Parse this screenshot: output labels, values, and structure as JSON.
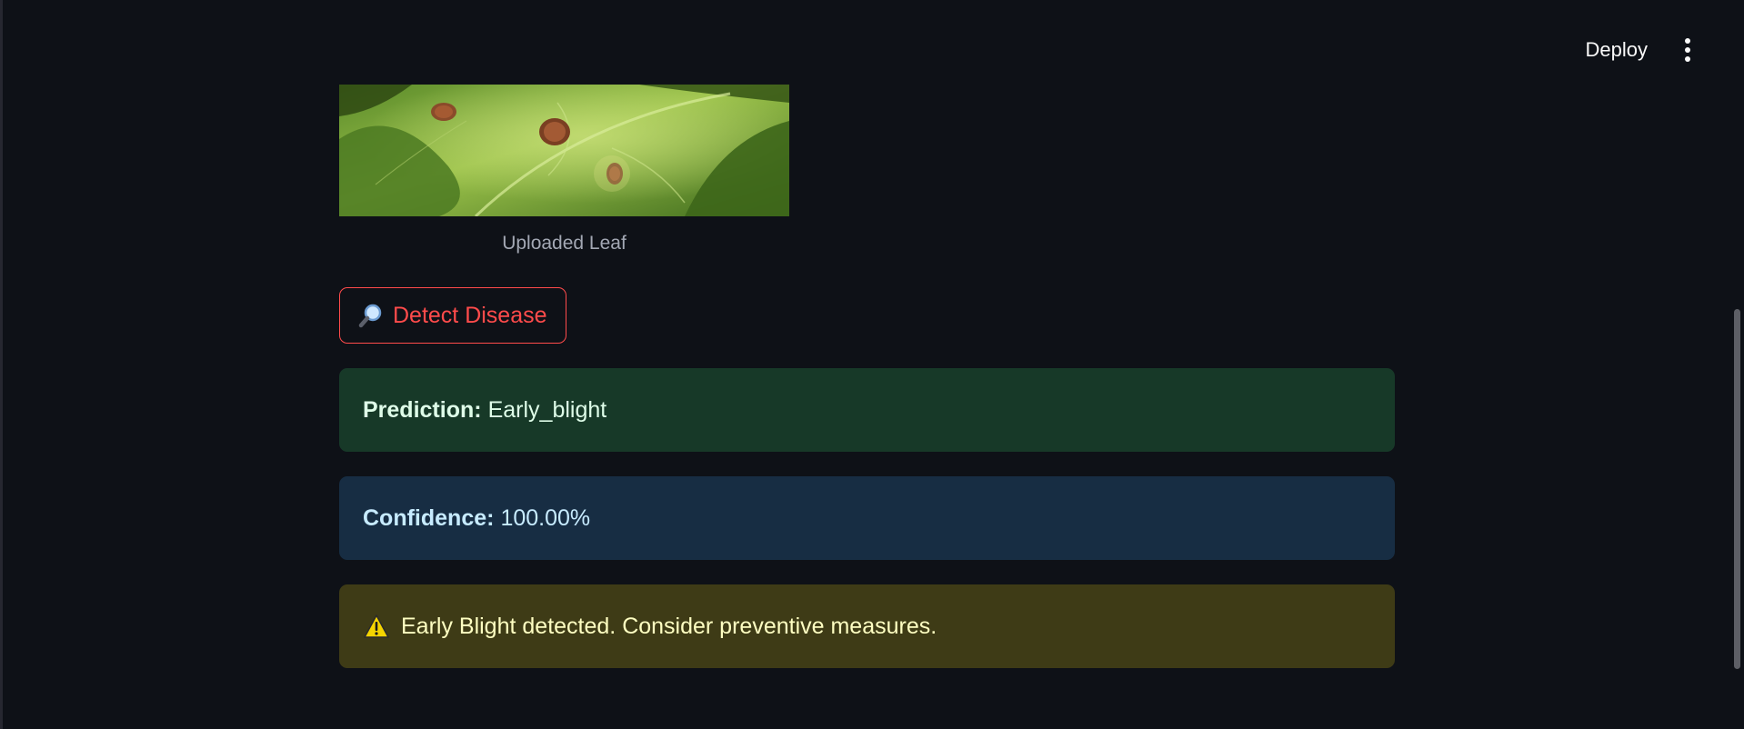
{
  "toolbar": {
    "deploy_label": "Deploy",
    "menu_icon": "kebab-menu-icon"
  },
  "upload": {
    "image_caption": "Uploaded Leaf"
  },
  "detect_button": {
    "icon": "magnifying-glass-icon",
    "label": "Detect Disease"
  },
  "results": {
    "prediction_label": "Prediction:",
    "prediction_value": "Early_blight",
    "confidence_label": "Confidence:",
    "confidence_value": "100.00%",
    "warning_icon": "warning-triangle-icon",
    "warning_text": "Early Blight detected. Consider preventive measures."
  },
  "colors": {
    "background": "#0e1117",
    "accent_red": "#ff4b4b",
    "success_bg": "#173928",
    "info_bg": "#172d43",
    "warning_bg": "#3e3b16"
  }
}
